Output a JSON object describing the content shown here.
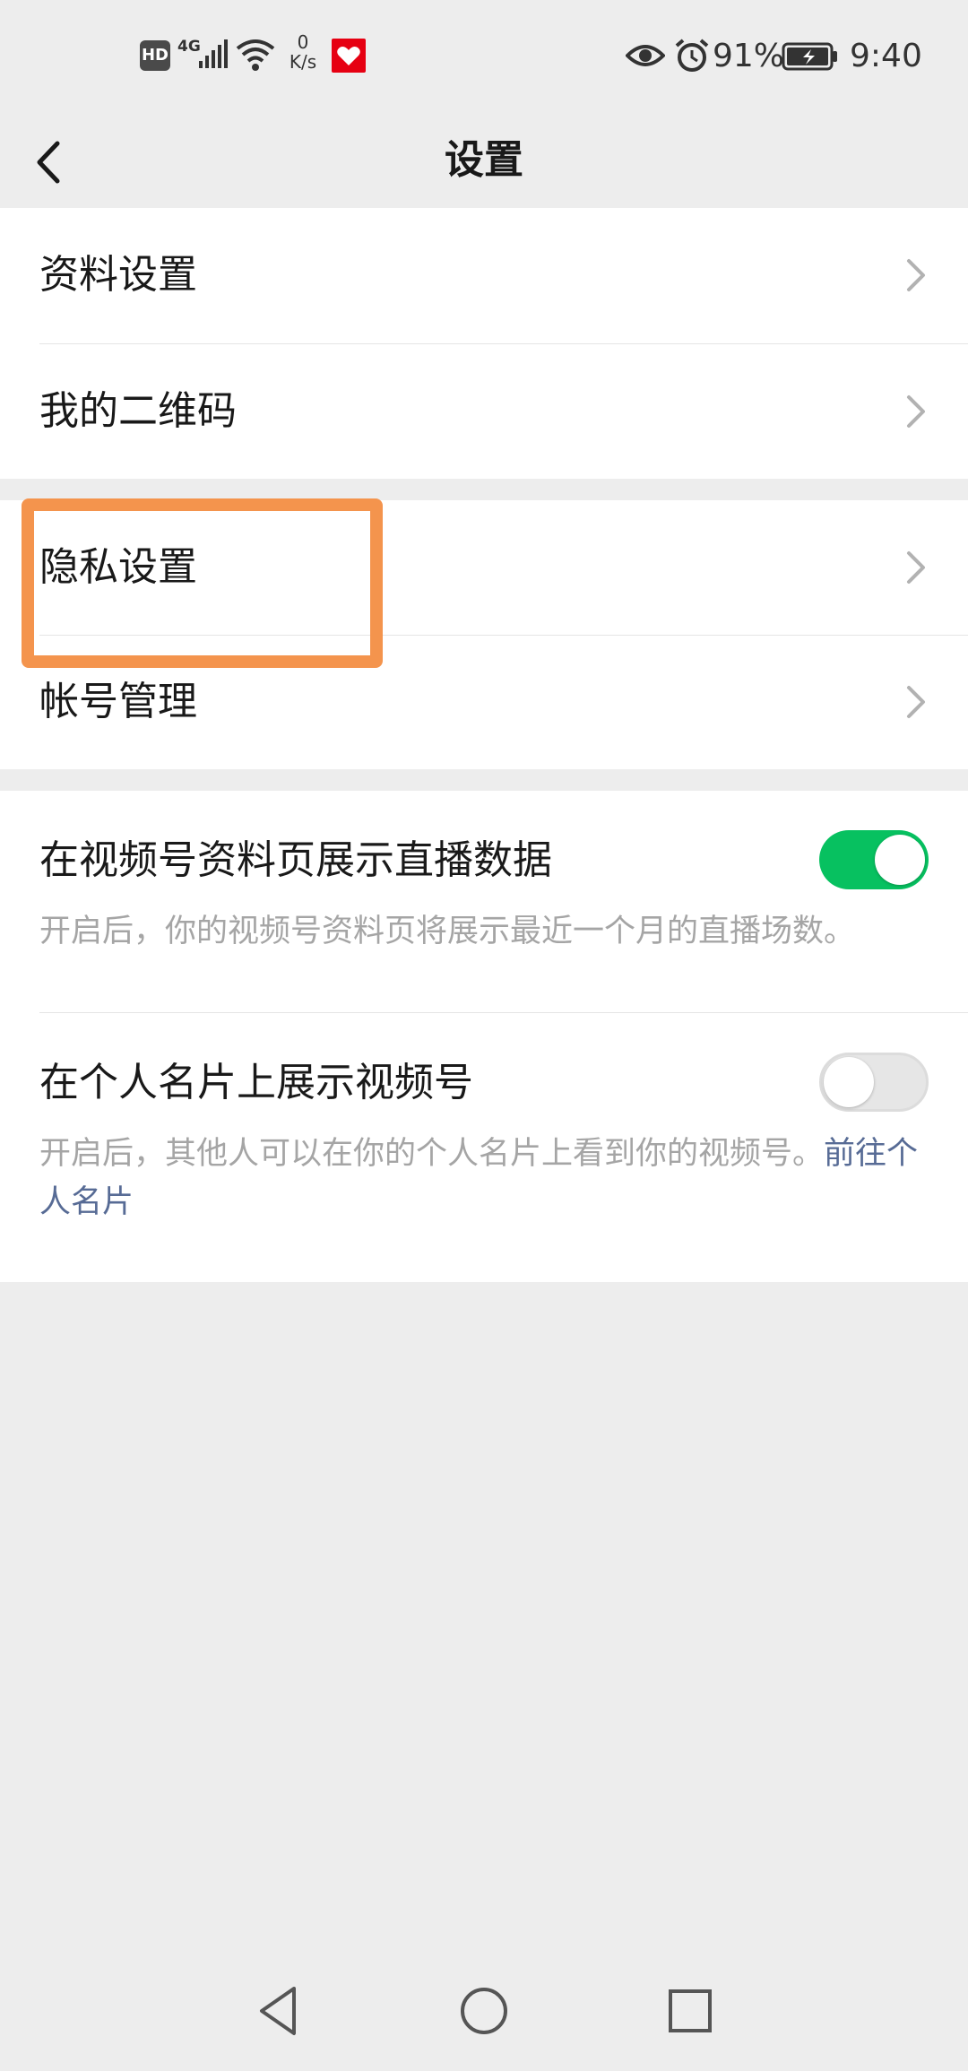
{
  "status_bar": {
    "hd": "HD",
    "network": "4G",
    "speed_value": "0",
    "speed_unit": "K/s",
    "battery_percent": "91%",
    "time": "9:40"
  },
  "nav": {
    "title": "设置"
  },
  "group1": {
    "items": [
      {
        "label": "资料设置"
      },
      {
        "label": "我的二维码"
      }
    ]
  },
  "group2": {
    "items": [
      {
        "label": "隐私设置"
      },
      {
        "label": "帐号管理"
      }
    ]
  },
  "group3": {
    "live_data": {
      "title": "在视频号资料页展示直播数据",
      "description": "开启后，你的视频号资料页将展示最近一个月的直播场数。",
      "enabled": true
    },
    "card": {
      "title": "在个人名片上展示视频号",
      "description": "开启后，其他人可以在你的个人名片上看到你的视频号。",
      "link": "前往个人名片",
      "enabled": false
    }
  },
  "colors": {
    "accent_green": "#07c160",
    "link_blue": "#576b95",
    "highlight_orange": "#f4944d",
    "background": "#ededed"
  },
  "icons": [
    "back-arrow-icon",
    "chevron-right-icon",
    "eye-icon",
    "alarm-icon",
    "battery-icon",
    "wifi-icon",
    "signal-icon",
    "nav-back-icon",
    "nav-home-icon",
    "nav-recents-icon"
  ]
}
